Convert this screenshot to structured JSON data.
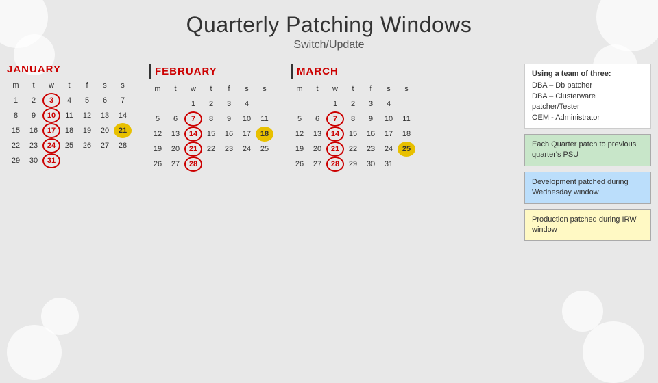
{
  "page": {
    "title": "Quarterly Patching Windows",
    "subtitle": "Switch/Update"
  },
  "info_panel": {
    "team_header": "Using a team of three:",
    "team_members": [
      "DBA – Db patcher",
      "DBA – Clusterware patcher/Tester",
      "OEM - Administrator"
    ],
    "quarter_patch": "Each Quarter patch to previous quarter's PSU",
    "dev_patched": "Development patched during Wednesday window",
    "prod_patched": "Production patched during IRW window"
  },
  "calendars": [
    {
      "month": "JANUARY",
      "days_header": [
        "m",
        "t",
        "w",
        "t",
        "f",
        "s",
        "s"
      ],
      "weeks": [
        [
          "1",
          "2",
          "3",
          "4",
          "5",
          "6",
          "7"
        ],
        [
          "8",
          "9",
          "10",
          "11",
          "12",
          "13",
          "14"
        ],
        [
          "15",
          "16",
          "17",
          "18",
          "19",
          "20",
          "21"
        ],
        [
          "22",
          "23",
          "24",
          "25",
          "26",
          "27",
          "28"
        ],
        [
          "29",
          "30",
          "31",
          "",
          "",
          "",
          ""
        ]
      ],
      "circled": [
        "3",
        "10",
        "17",
        "24",
        "31"
      ],
      "highlighted": [
        "21"
      ]
    },
    {
      "month": "FEBRUARY",
      "days_header": [
        "m",
        "t",
        "w",
        "t",
        "f",
        "s",
        "s"
      ],
      "weeks": [
        [
          "",
          "",
          "1",
          "2",
          "3",
          "4",
          ""
        ],
        [
          "5",
          "6",
          "7",
          "8",
          "9",
          "10",
          "11"
        ],
        [
          "12",
          "13",
          "14",
          "15",
          "16",
          "17",
          "18"
        ],
        [
          "19",
          "20",
          "21",
          "22",
          "23",
          "24",
          "25"
        ],
        [
          "26",
          "27",
          "28",
          "",
          "",
          "",
          ""
        ]
      ],
      "circled": [
        "7",
        "14",
        "21",
        "28"
      ],
      "highlighted": [
        "18"
      ]
    },
    {
      "month": "MARCH",
      "days_header": [
        "m",
        "t",
        "w",
        "t",
        "f",
        "s",
        "s"
      ],
      "weeks": [
        [
          "",
          "",
          "1",
          "2",
          "3",
          "4",
          ""
        ],
        [
          "5",
          "6",
          "7",
          "8",
          "9",
          "10",
          "11"
        ],
        [
          "12",
          "13",
          "14",
          "15",
          "16",
          "17",
          "18"
        ],
        [
          "19",
          "20",
          "21",
          "22",
          "23",
          "24",
          "25"
        ],
        [
          "26",
          "27",
          "28",
          "29",
          "30",
          "31",
          ""
        ]
      ],
      "circled": [
        "7",
        "14",
        "21",
        "28"
      ],
      "highlighted": [
        "25"
      ]
    }
  ]
}
